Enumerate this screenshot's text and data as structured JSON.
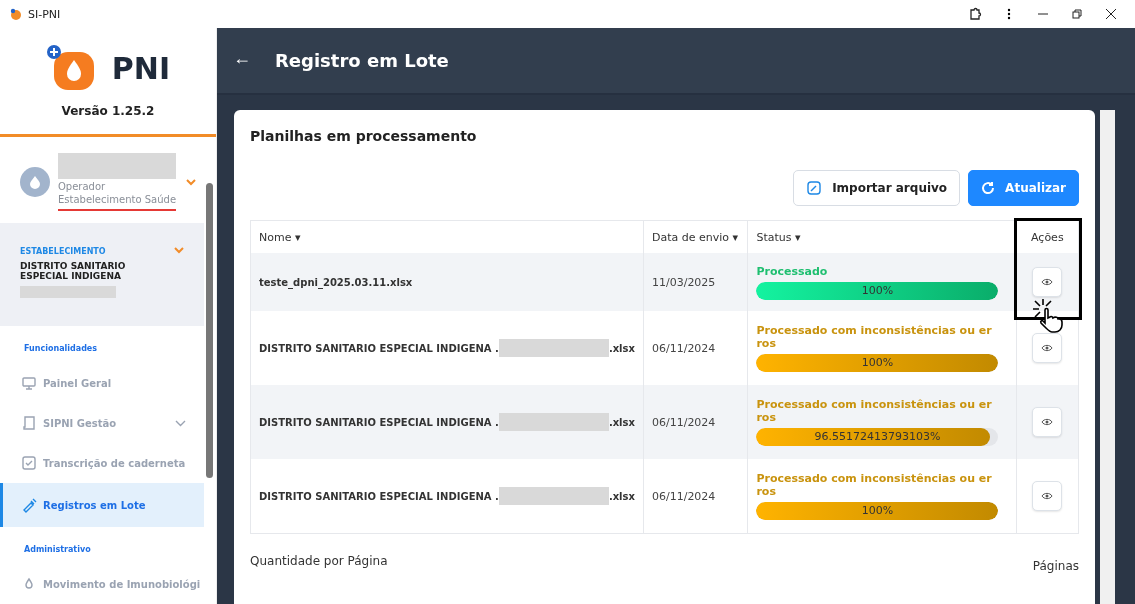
{
  "window": {
    "title": "SI-PNI"
  },
  "sidebar": {
    "logo_text": "PNI",
    "version": "Versão 1.25.2",
    "user": {
      "role": "Operador",
      "unit": "Estabelecimento Saúde"
    },
    "establishment": {
      "label": "ESTABELECIMENTO",
      "name": "DISTRITO SANITARIO ESPECIAL INDIGENA"
    },
    "sections": [
      {
        "title": "Funcionalidades",
        "items": [
          {
            "label": "Painel Geral",
            "selected": false,
            "expandable": false
          },
          {
            "label": "SIPNI Gestão",
            "selected": false,
            "expandable": true
          },
          {
            "label": "Transcrição de caderneta",
            "selected": false,
            "expandable": false
          },
          {
            "label": "Registros em Lote",
            "selected": true,
            "expandable": false
          }
        ]
      },
      {
        "title": "Administrativo",
        "items": [
          {
            "label": "Movimento de Imunobiológi",
            "selected": false,
            "expandable": false
          }
        ]
      }
    ]
  },
  "header": {
    "back": "←",
    "title": "Registro em Lote"
  },
  "card": {
    "title": "Planilhas em processamento",
    "buttons": [
      {
        "label": "Importar arquivo",
        "kind": "outline"
      },
      {
        "label": "Atualizar",
        "kind": "primary"
      }
    ],
    "table": {
      "columns": [
        {
          "label": "Nome",
          "sort_icon": "▾"
        },
        {
          "label": "Data de envio",
          "sort_icon": "▾"
        },
        {
          "label": "Status",
          "sort_icon": "▾"
        },
        {
          "label": "Ações"
        }
      ],
      "rows": [
        {
          "name_prefix": "teste_dpni_2025.03.11.xlsx",
          "redacted": false,
          "date": "11/03/2025",
          "status": "Processado",
          "kind": "success",
          "level": 1,
          "percent": "100%"
        },
        {
          "name_prefix": "DISTRITO SANITARIO ESPECIAL INDIGENA .",
          "redacted": true,
          "name_suffix": ".xlsx",
          "date": "06/11/2024",
          "status": "Processado com inconsistências ou erros",
          "kind": "warning",
          "level": 1,
          "percent": "100%"
        },
        {
          "name_prefix": "DISTRITO SANITARIO ESPECIAL INDIGENA .",
          "redacted": true,
          "name_suffix": ".xlsx",
          "date": "06/11/2024",
          "status": "Processado com inconsistências ou erros",
          "kind": "warning",
          "level": 0.9655,
          "percent": "96.55172413793103%"
        },
        {
          "name_prefix": "DISTRITO SANITARIO ESPECIAL INDIGENA .",
          "redacted": true,
          "name_suffix": ".xlsx",
          "date": "06/11/2024",
          "status": "Processado com inconsistências ou erros",
          "kind": "warning",
          "level": 1,
          "percent": "100%"
        }
      ]
    },
    "footer": {
      "per_page_label": "Quantidade por Página",
      "pages_label": "Páginas"
    }
  }
}
